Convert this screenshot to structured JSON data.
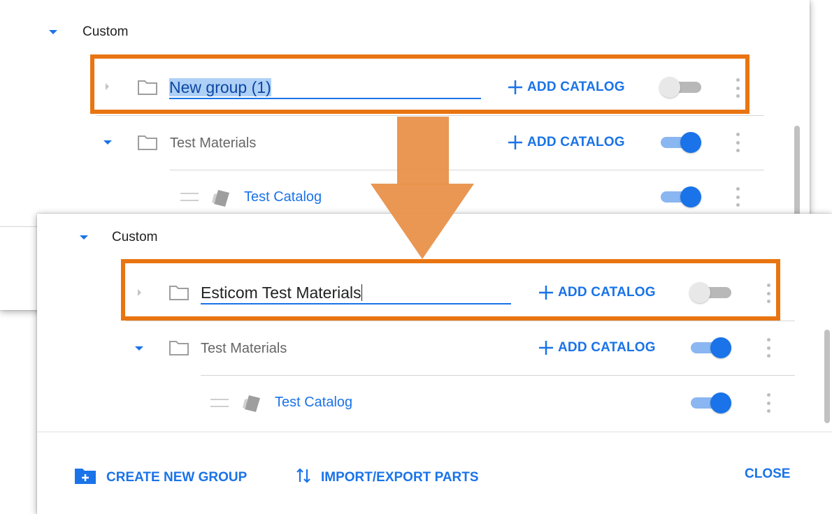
{
  "before": {
    "section_label": "Custom",
    "editing_group": {
      "name": "New group (1)",
      "add_catalog_label": "ADD CATALOG",
      "toggle": "off"
    },
    "group": {
      "name": "Test Materials",
      "add_catalog_label": "ADD CATALOG",
      "toggle": "on"
    },
    "catalog": {
      "name": "Test Catalog",
      "toggle": "on"
    }
  },
  "after": {
    "section_label": "Custom",
    "editing_group": {
      "name": "Esticom Test Materials",
      "add_catalog_label": "ADD CATALOG",
      "toggle": "off"
    },
    "group": {
      "name": "Test Materials",
      "add_catalog_label": "ADD CATALOG",
      "toggle": "on"
    },
    "catalog": {
      "name": "Test Catalog",
      "toggle": "on"
    },
    "footer": {
      "create_group_label": "CREATE NEW GROUP",
      "import_export_label": "IMPORT/EXPORT PARTS",
      "close_label": "CLOSE"
    }
  },
  "colors": {
    "accent": "#1a73e8",
    "highlight": "#e87511",
    "arrow": "#e8914a"
  },
  "icons": [
    "caret-down-icon",
    "caret-right-icon",
    "folder-icon",
    "plus-icon",
    "tag-icon",
    "drag-handle-icon",
    "more-vert-icon",
    "create-folder-icon",
    "sort-arrows-icon"
  ]
}
